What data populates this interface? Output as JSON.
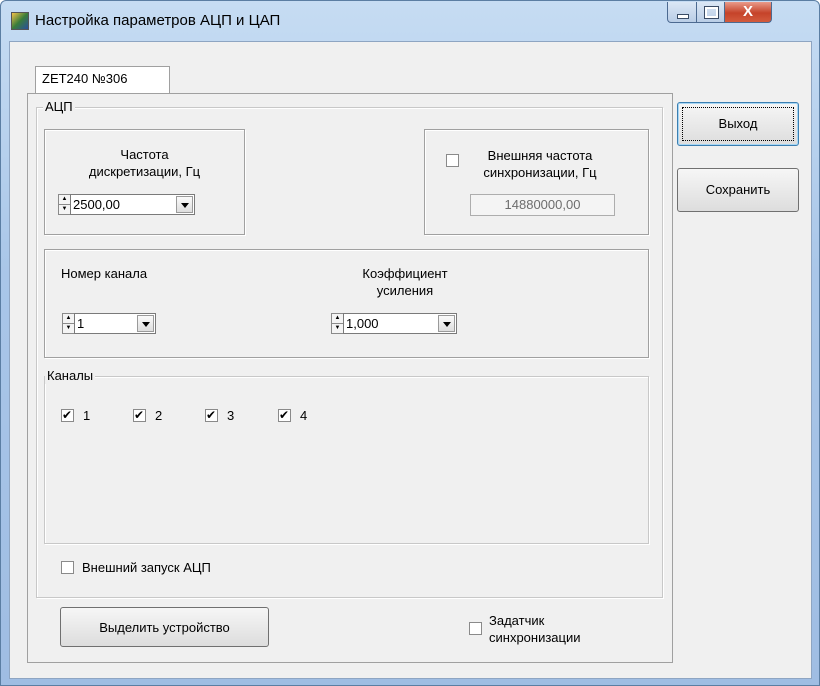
{
  "window": {
    "title": "Настройка параметров АЦП и ЦАП",
    "close_glyph": "X"
  },
  "tab": {
    "label": "ZET240 №306"
  },
  "adc_group": {
    "legend": "АЦП",
    "sampling": {
      "label_line1": "Частота",
      "label_line2": "дискретизации, Гц",
      "value": "2500,00"
    },
    "external_freq": {
      "label_line1": "Внешняя частота",
      "label_line2": "синхронизации, Гц",
      "checked": false,
      "value": "14880000,00"
    },
    "channel": {
      "label": "Номер канала",
      "value": "1"
    },
    "gain": {
      "label_line1": "Коэффициент",
      "label_line2": "усиления",
      "value": "1,000"
    },
    "channels_group": {
      "legend": "Каналы",
      "items": [
        {
          "label": "1",
          "checked": true
        },
        {
          "label": "2",
          "checked": true
        },
        {
          "label": "3",
          "checked": true
        },
        {
          "label": "4",
          "checked": true
        }
      ]
    },
    "external_start": {
      "label": "Внешний запуск АЦП",
      "checked": false
    }
  },
  "select_device_button": "Выделить устройство",
  "sync_source": {
    "label_line1": "Задатчик",
    "label_line2": "синхронизации",
    "checked": false
  },
  "side_buttons": {
    "exit": "Выход",
    "save": "Сохранить"
  },
  "icons": {
    "window_icon": "app-icon",
    "spin": "spin-updown-icon",
    "combo": "chevron-down-icon"
  }
}
